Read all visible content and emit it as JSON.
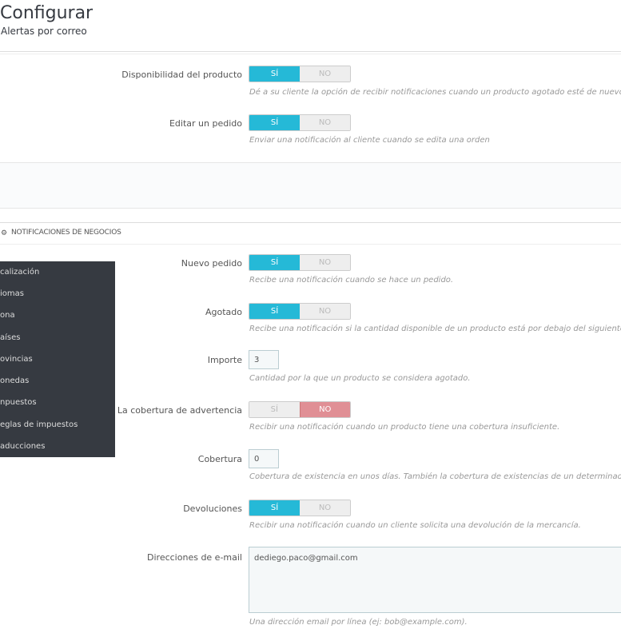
{
  "header": {
    "title": "Configurar",
    "subtitle": "Alertas por correo"
  },
  "customer": {
    "rows": [
      {
        "label": "Disponibilidad del producto",
        "yes": "SÍ",
        "no": "NO",
        "selected": "yes",
        "help": "Dé a su cliente la opción de recibir notificaciones cuando un producto agotado esté de nuevo dis"
      },
      {
        "label": "Editar un pedido",
        "yes": "SÍ",
        "no": "NO",
        "selected": "yes",
        "help": "Enviar una notificación al cliente cuando se edita una orden"
      }
    ]
  },
  "business": {
    "heading": "NOTIFICACIONES DE NEGOCIOS",
    "new_order": {
      "label": "Nuevo pedido",
      "yes": "SÍ",
      "no": "NO",
      "help": "Recibe una notificación cuando se hace un pedido."
    },
    "out_of_stock": {
      "label": "Agotado",
      "yes": "SÍ",
      "no": "NO",
      "help": "Recibe una notificación si la cantidad disponible de un producto está por debajo del siguiente un"
    },
    "amount": {
      "label": "Importe",
      "value": "3",
      "help": "Cantidad por la que un producto se considera agotado."
    },
    "coverage_warning": {
      "label": "La cobertura de advertencia",
      "yes": "SÍ",
      "no": "NO",
      "help": "Recibir una notificación cuando un producto tiene una cobertura insuficiente."
    },
    "coverage": {
      "label": "Cobertura",
      "value": "0",
      "help": "Cobertura de existencia en unos días. También la cobertura de existencias de un determinado p"
    },
    "returns": {
      "label": "Devoluciones",
      "yes": "SÍ",
      "no": "NO",
      "help": "Recibir una notificación cuando un cliente solicita una devolución de la mercancía."
    },
    "emails": {
      "label": "Direcciones de e-mail",
      "value": "dediego.paco@gmail.com",
      "help": "Una dirección email por línea (ej: bob@example.com)."
    }
  },
  "menu": {
    "items": [
      "calización",
      "iomas",
      "ona",
      "aíses",
      "ovincias",
      "onedas",
      "npuestos",
      "eglas de impuestos",
      "aducciones"
    ]
  },
  "colors": {
    "accent": "#25b9d7",
    "no_active": "#e08f95",
    "menu_bg": "#363a41"
  }
}
